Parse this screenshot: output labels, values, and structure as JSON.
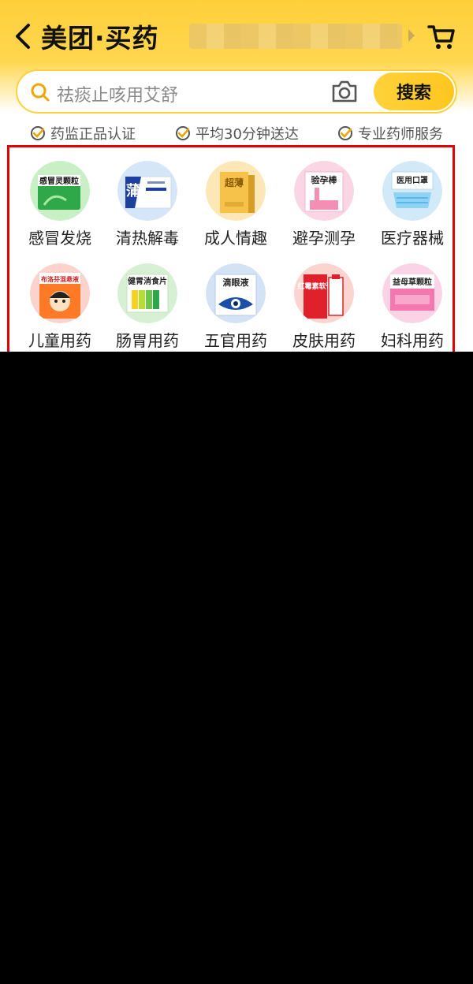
{
  "header": {
    "title": "美团·买药",
    "colors": {
      "brand_yellow": "#ffd23a",
      "highlight_frame": "#e20000"
    }
  },
  "search": {
    "placeholder": "祛痰止咳用艾舒",
    "button_label": "搜索"
  },
  "badges": [
    {
      "label": "药监正品认证"
    },
    {
      "label": "平均30分钟送达"
    },
    {
      "label": "专业药师服务"
    }
  ],
  "categories": [
    {
      "label": "感冒发烧",
      "pack_text": "感冒灵颗粒",
      "icon": "cold-medicine-icon"
    },
    {
      "label": "清热解毒",
      "pack_text": "蒲",
      "icon": "detox-medicine-icon"
    },
    {
      "label": "成人情趣",
      "pack_text": "超薄",
      "icon": "adult-product-icon"
    },
    {
      "label": "避孕测孕",
      "pack_text": "验孕棒",
      "icon": "pregnancy-test-icon"
    },
    {
      "label": "医疗器械",
      "pack_text": "医用口罩",
      "icon": "mask-icon"
    },
    {
      "label": "儿童用药",
      "pack_text": "布洛芬混悬液",
      "icon": "child-medicine-icon"
    },
    {
      "label": "肠胃用药",
      "pack_text": "健胃消食片",
      "icon": "stomach-medicine-icon"
    },
    {
      "label": "五官用药",
      "pack_text": "滴眼液",
      "icon": "eye-drops-icon"
    },
    {
      "label": "皮肤用药",
      "pack_text": "红霉素软膏",
      "icon": "skin-ointment-icon"
    },
    {
      "label": "妇科用药",
      "pack_text": "益母草颗粒",
      "icon": "gynecology-medicine-icon"
    }
  ]
}
